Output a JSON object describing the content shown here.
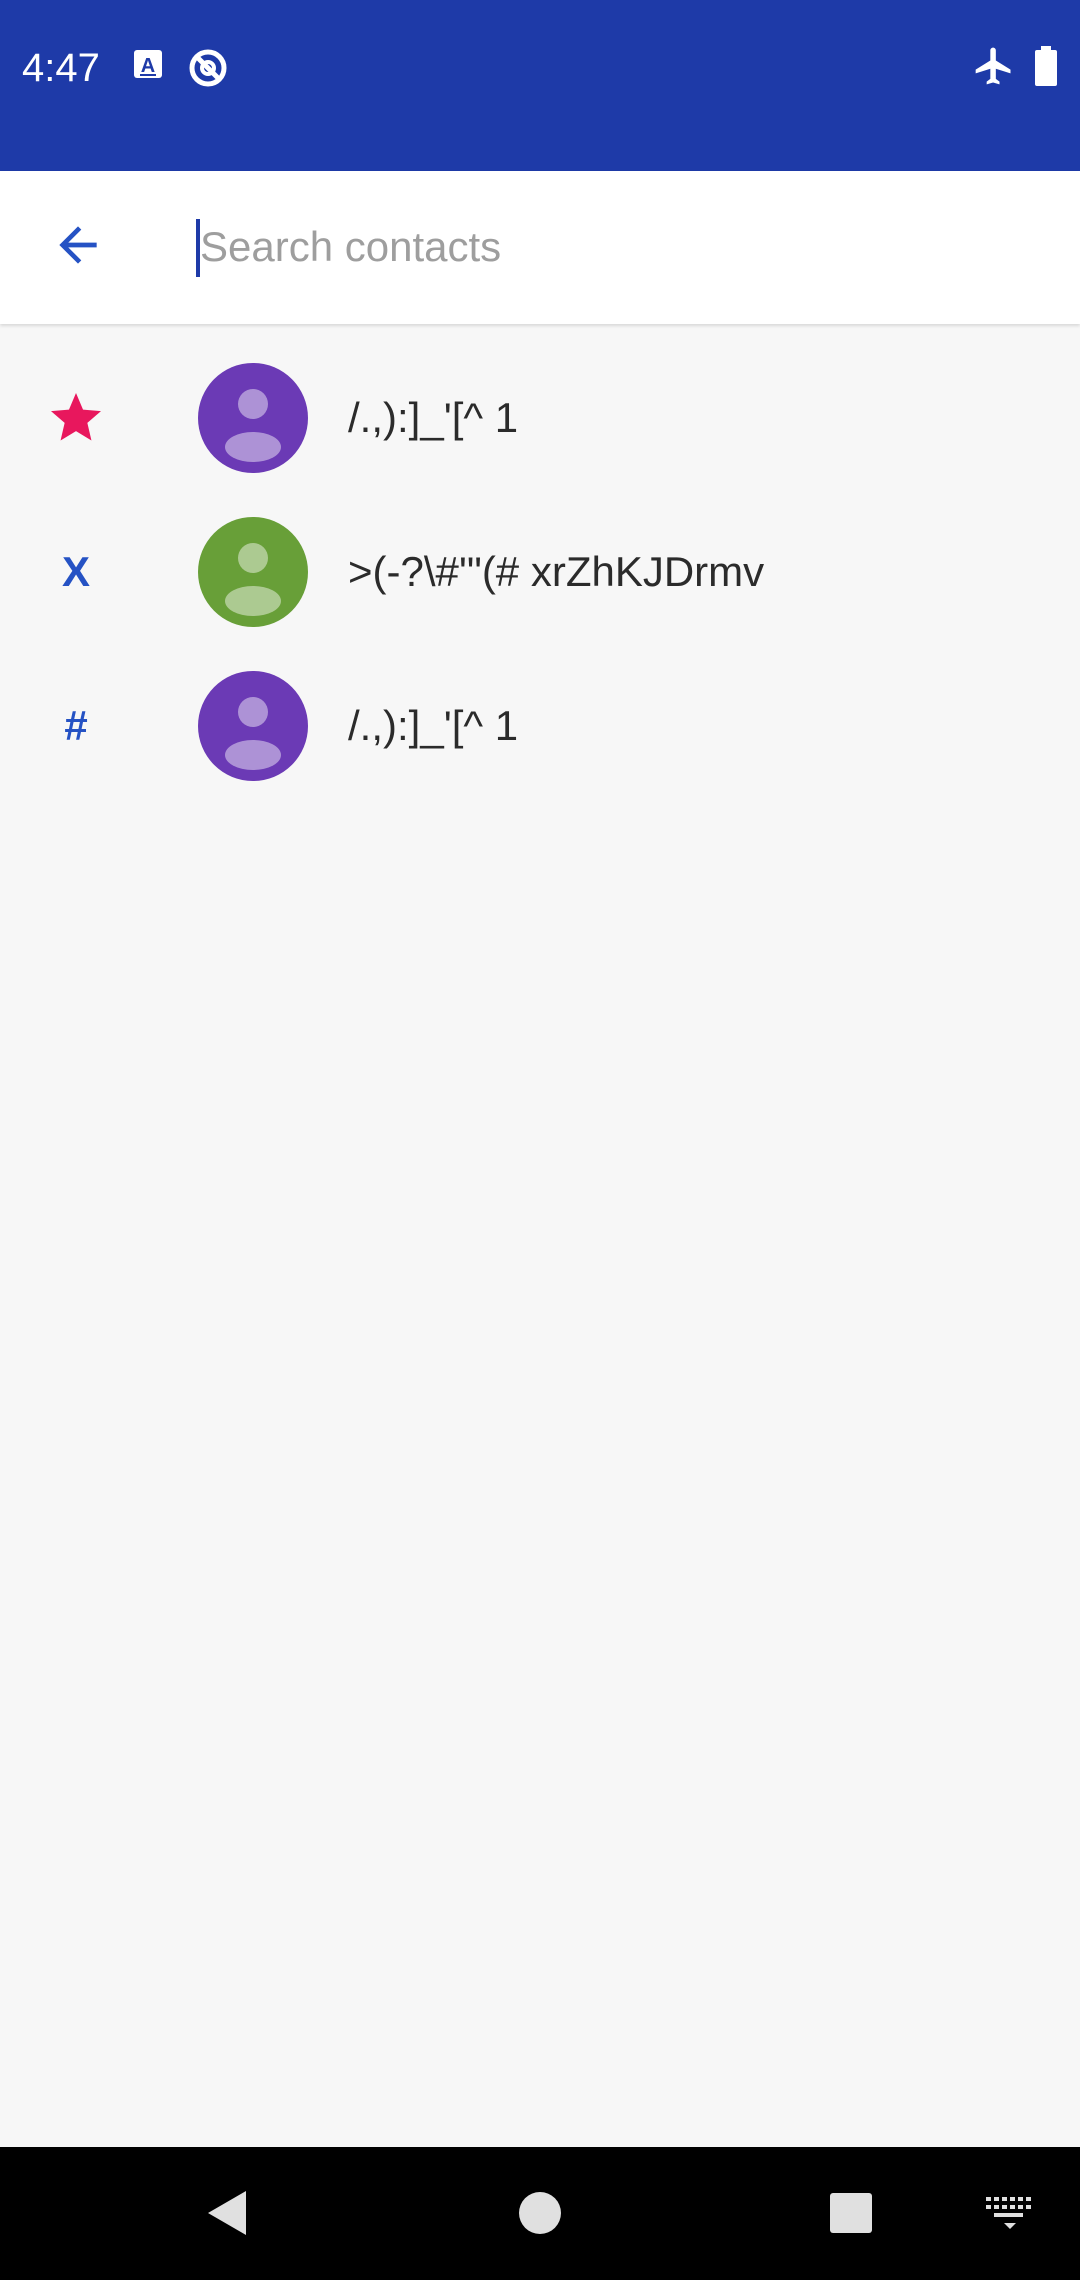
{
  "status_bar": {
    "time": "4:47",
    "background_color": "#1e3aa8",
    "left_icons": [
      "a-keyboard-icon",
      "no-disturb-icon"
    ],
    "right_icons": [
      "airplane-mode-icon",
      "battery-icon"
    ]
  },
  "search": {
    "placeholder": "Search contacts",
    "value": "",
    "back_icon": "arrow-back-icon"
  },
  "contacts": [
    {
      "section_header": "★",
      "section_header_type": "starred",
      "header_color": "#e8175d",
      "avatar_color": "#6b3ab5",
      "name": "/.,):]_'[^ 1"
    },
    {
      "section_header": "X",
      "section_header_type": "letter",
      "header_color": "#2552c4",
      "avatar_color": "#689f38",
      "name": ">(-?\\#'\"(# xrZhKJDrmv"
    },
    {
      "section_header": "#",
      "section_header_type": "symbol",
      "header_color": "#2552c4",
      "avatar_color": "#6b3ab5",
      "name": "/.,):]_'[^ 1"
    }
  ],
  "nav_bar": {
    "buttons": [
      "back-nav-icon",
      "home-nav-icon",
      "recents-nav-icon",
      "keyboard-switch-icon"
    ]
  }
}
